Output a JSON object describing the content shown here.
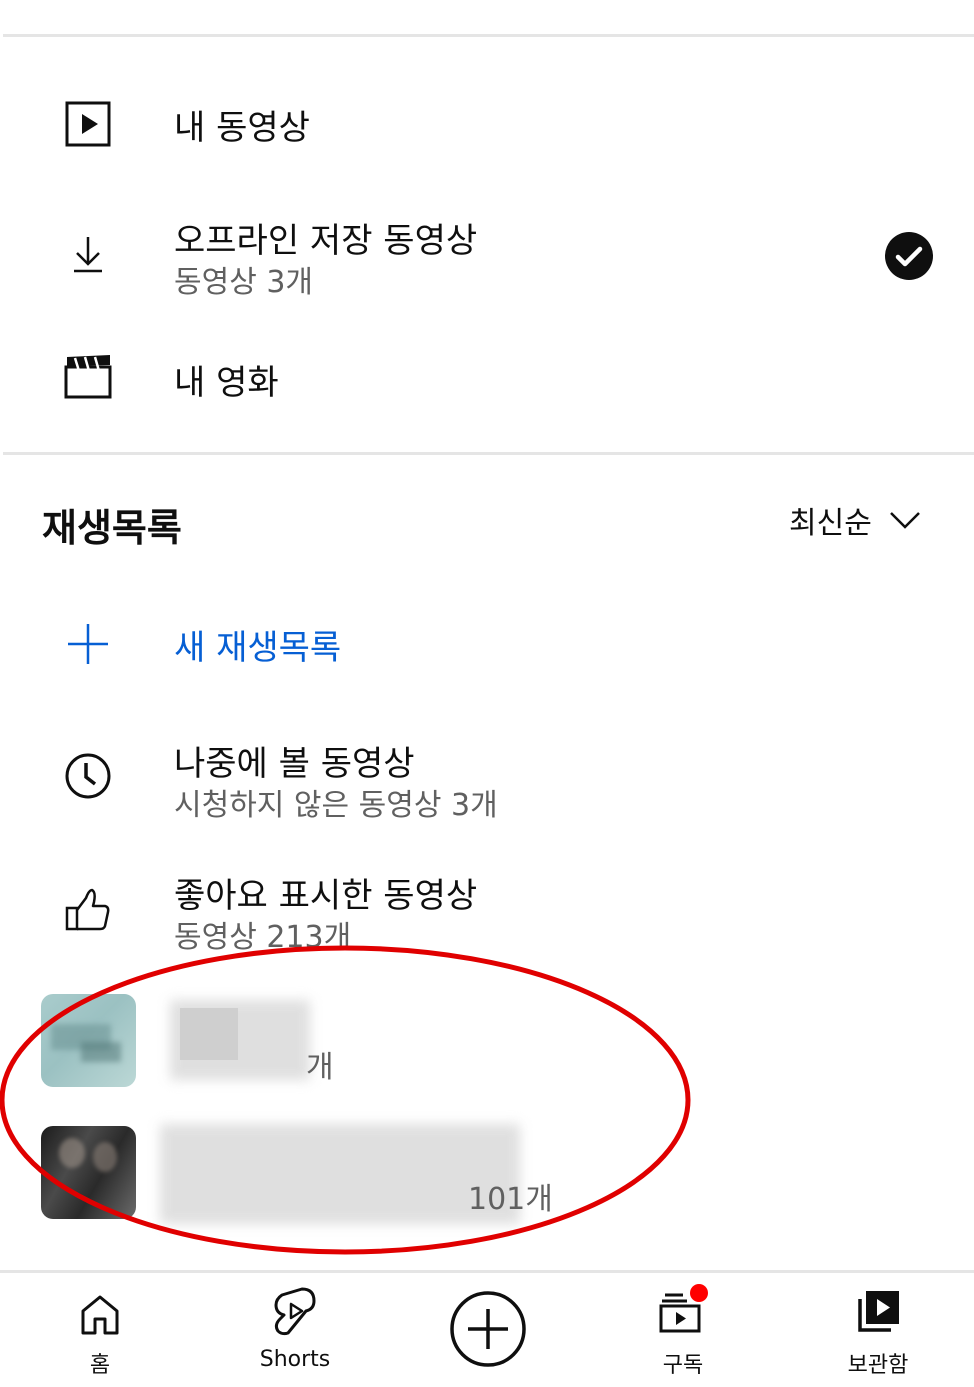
{
  "library": {
    "my_videos": {
      "label": "내 동영상",
      "icon": "play-square-icon"
    },
    "offline": {
      "label": "오프라인 저장 동영상",
      "sub": "동영상 3개",
      "icon": "download-icon",
      "status_icon": "check-circle-icon"
    },
    "my_movies": {
      "label": "내 영화",
      "icon": "clapperboard-icon"
    }
  },
  "playlists": {
    "title": "재생목록",
    "sort_label": "최신순",
    "new_playlist_label": "새 재생목록",
    "items": [
      {
        "label": "나중에 볼 동영상",
        "sub": "시청하지 않은 동영상 3개",
        "icon": "clock-icon"
      },
      {
        "label": "좋아요 표시한 동영상",
        "sub": "동영상 213개",
        "icon": "thumbs-up-icon"
      },
      {
        "label": "",
        "sub": "개",
        "icon": "playlist-thumbnail"
      },
      {
        "label": "",
        "sub": "101개",
        "icon": "playlist-thumbnail"
      }
    ]
  },
  "annotation_color": "#e00000",
  "accent_color": "#065fd4",
  "nav": {
    "items": [
      {
        "label": "홈",
        "icon": "home-icon"
      },
      {
        "label": "Shorts",
        "icon": "shorts-icon"
      },
      {
        "label": "",
        "icon": "create-plus-icon"
      },
      {
        "label": "구독",
        "icon": "subscriptions-icon"
      },
      {
        "label": "보관함",
        "icon": "library-icon"
      }
    ],
    "badge_color": "#ff0000"
  }
}
